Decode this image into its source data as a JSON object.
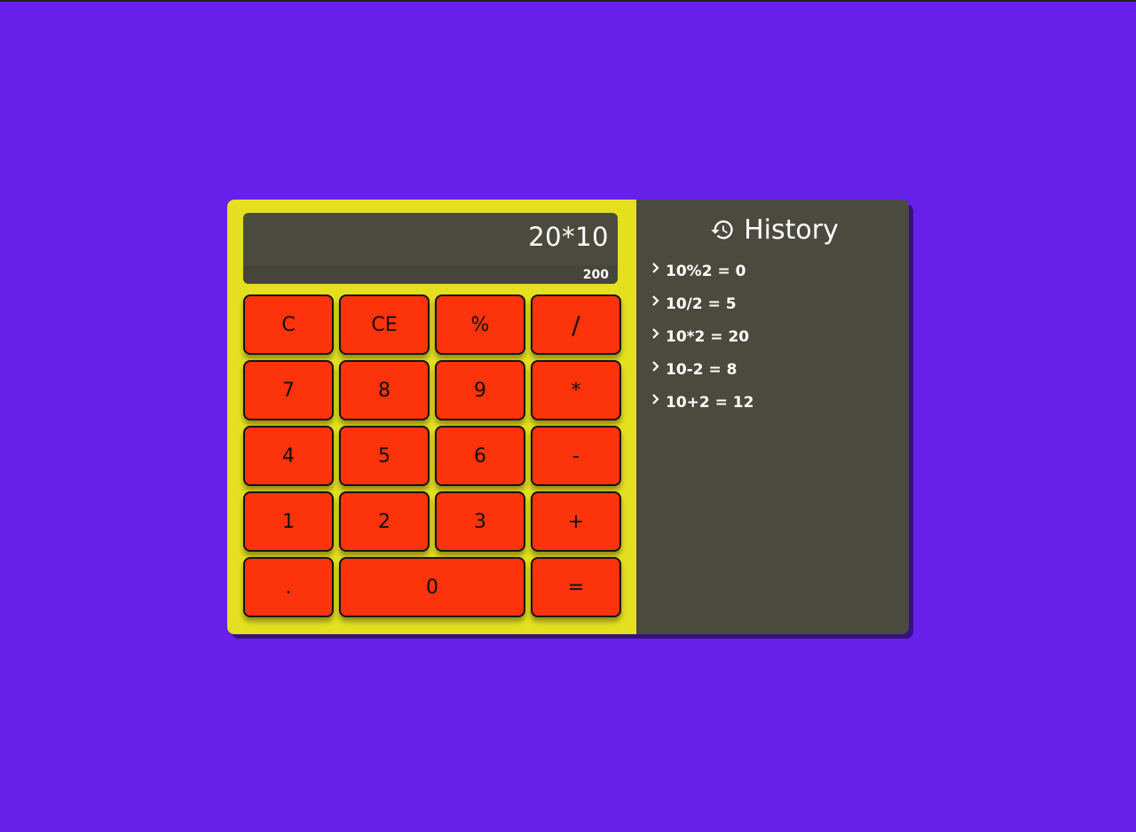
{
  "display": {
    "expression": "20*10",
    "result": "200"
  },
  "keys": [
    {
      "label": "C",
      "name": "clear-button"
    },
    {
      "label": "CE",
      "name": "clear-entry-button"
    },
    {
      "label": "%",
      "name": "modulo-button"
    },
    {
      "label": "/",
      "name": "divide-button"
    },
    {
      "label": "7",
      "name": "digit-7-button"
    },
    {
      "label": "8",
      "name": "digit-8-button"
    },
    {
      "label": "9",
      "name": "digit-9-button"
    },
    {
      "label": "*",
      "name": "multiply-button"
    },
    {
      "label": "4",
      "name": "digit-4-button"
    },
    {
      "label": "5",
      "name": "digit-5-button"
    },
    {
      "label": "6",
      "name": "digit-6-button"
    },
    {
      "label": "-",
      "name": "subtract-button"
    },
    {
      "label": "1",
      "name": "digit-1-button"
    },
    {
      "label": "2",
      "name": "digit-2-button"
    },
    {
      "label": "3",
      "name": "digit-3-button"
    },
    {
      "label": "+",
      "name": "add-button"
    },
    {
      "label": ".",
      "name": "decimal-button"
    },
    {
      "label": "0",
      "name": "digit-0-button"
    },
    {
      "label": "=",
      "name": "equals-button"
    }
  ],
  "history": {
    "title": "History",
    "icon": "history-icon",
    "items": [
      "10%2 = 0",
      "10/2 = 5",
      "10*2 = 20",
      "10-2 = 8",
      "10+2 = 12"
    ]
  },
  "colors": {
    "background": "#6620e9",
    "calculator": "#e4e01f",
    "display": "#4b4a3f",
    "key": "#fc330b",
    "history_panel": "#4b4a3f"
  }
}
